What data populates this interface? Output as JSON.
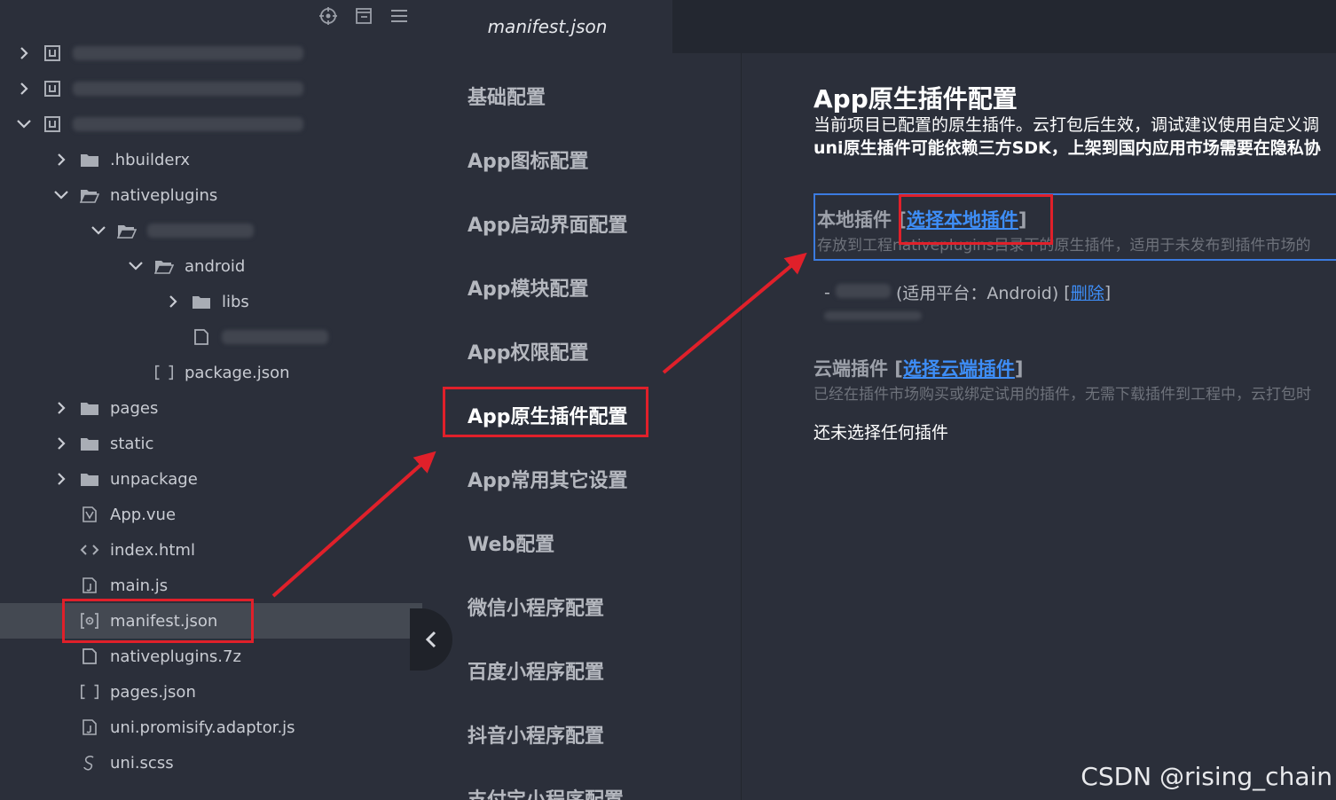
{
  "explorer": {
    "tree": [
      {
        "name": "tree-item-project-1",
        "label": "",
        "depth": 0,
        "chevron": "right",
        "icon": "project-icon",
        "blur": true
      },
      {
        "name": "tree-item-project-2",
        "label": "",
        "depth": 0,
        "chevron": "right",
        "icon": "project-icon",
        "blur": true
      },
      {
        "name": "tree-item-project-3",
        "label": "",
        "depth": 0,
        "chevron": "down",
        "icon": "project-icon",
        "blur": true
      },
      {
        "name": "tree-item-hbuilderx",
        "label": ".hbuilderx",
        "depth": 1,
        "chevron": "right",
        "icon": "folder-icon"
      },
      {
        "name": "tree-item-nativeplugins",
        "label": "nativeplugins",
        "depth": 1,
        "chevron": "down",
        "icon": "folder-open-icon"
      },
      {
        "name": "tree-item-plugin-folder",
        "label": "",
        "depth": 2,
        "chevron": "down",
        "icon": "folder-open-icon",
        "blur": true
      },
      {
        "name": "tree-item-android",
        "label": "android",
        "depth": 3,
        "chevron": "down",
        "icon": "folder-open-icon"
      },
      {
        "name": "tree-item-libs",
        "label": "libs",
        "depth": 4,
        "chevron": "right",
        "icon": "folder-icon"
      },
      {
        "name": "tree-item-blurred-file",
        "label": "",
        "depth": 4,
        "chevron": "none",
        "icon": "file-icon",
        "blur": true
      },
      {
        "name": "tree-item-package-json",
        "label": "package.json",
        "depth": 3,
        "chevron": "none",
        "icon": "json-icon"
      },
      {
        "name": "tree-item-pages",
        "label": "pages",
        "depth": 1,
        "chevron": "right",
        "icon": "folder-icon"
      },
      {
        "name": "tree-item-static",
        "label": "static",
        "depth": 1,
        "chevron": "right",
        "icon": "folder-icon"
      },
      {
        "name": "tree-item-unpackage",
        "label": "unpackage",
        "depth": 1,
        "chevron": "right",
        "icon": "folder-icon"
      },
      {
        "name": "tree-item-app-vue",
        "label": "App.vue",
        "depth": 1,
        "chevron": "none",
        "icon": "vue-icon"
      },
      {
        "name": "tree-item-index-html",
        "label": "index.html",
        "depth": 1,
        "chevron": "none",
        "icon": "html-icon"
      },
      {
        "name": "tree-item-main-js",
        "label": "main.js",
        "depth": 1,
        "chevron": "none",
        "icon": "js-icon"
      },
      {
        "name": "tree-item-manifest-json",
        "label": "manifest.json",
        "depth": 1,
        "chevron": "none",
        "icon": "manifest-icon",
        "selected": true
      },
      {
        "name": "tree-item-nativeplugins-7z",
        "label": "nativeplugins.7z",
        "depth": 1,
        "chevron": "none",
        "icon": "file-icon"
      },
      {
        "name": "tree-item-pages-json",
        "label": "pages.json",
        "depth": 1,
        "chevron": "none",
        "icon": "json-icon"
      },
      {
        "name": "tree-item-adaptor-js",
        "label": "uni.promisify.adaptor.js",
        "depth": 1,
        "chevron": "none",
        "icon": "js-icon"
      },
      {
        "name": "tree-item-uni-scss",
        "label": "uni.scss",
        "depth": 1,
        "chevron": "none",
        "icon": "scss-icon"
      }
    ]
  },
  "editor": {
    "tab_title": "manifest.json"
  },
  "nav": {
    "items": [
      "基础配置",
      "App图标配置",
      "App启动界面配置",
      "App模块配置",
      "App权限配置",
      "App原生插件配置",
      "App常用其它设置",
      "Web配置",
      "微信小程序配置",
      "百度小程序配置",
      "抖音小程序配置",
      "支付宝小程序配置"
    ],
    "active_index": 5
  },
  "content": {
    "title": "App原生插件配置",
    "desc1": "当前项目已配置的原生插件。云打包后生效，调试建议使用自定义调",
    "desc2": "uni原生插件可能依赖三方SDK，上架到国内应用市场需要在隐私协",
    "local": {
      "label": "本地插件",
      "link": "选择本地插件",
      "desc": "存放到工程nativeplugins目录下的原生插件，适用于未发布到插件市场的"
    },
    "plugin_entry": {
      "platform": "(适用平台：Android)",
      "delete": "删除"
    },
    "cloud": {
      "label": "云端插件",
      "link": "选择云端插件",
      "desc": "已经在插件市场购买或绑定试用的插件，无需下载插件到工程中，云打包时"
    },
    "empty_text": "还未选择任何插件"
  },
  "watermark": "CSDN @rising_chain",
  "colors": {
    "accent_link": "#3e8ef7",
    "annotation_red": "#e0202a",
    "focus_blue": "#3b7be0"
  }
}
